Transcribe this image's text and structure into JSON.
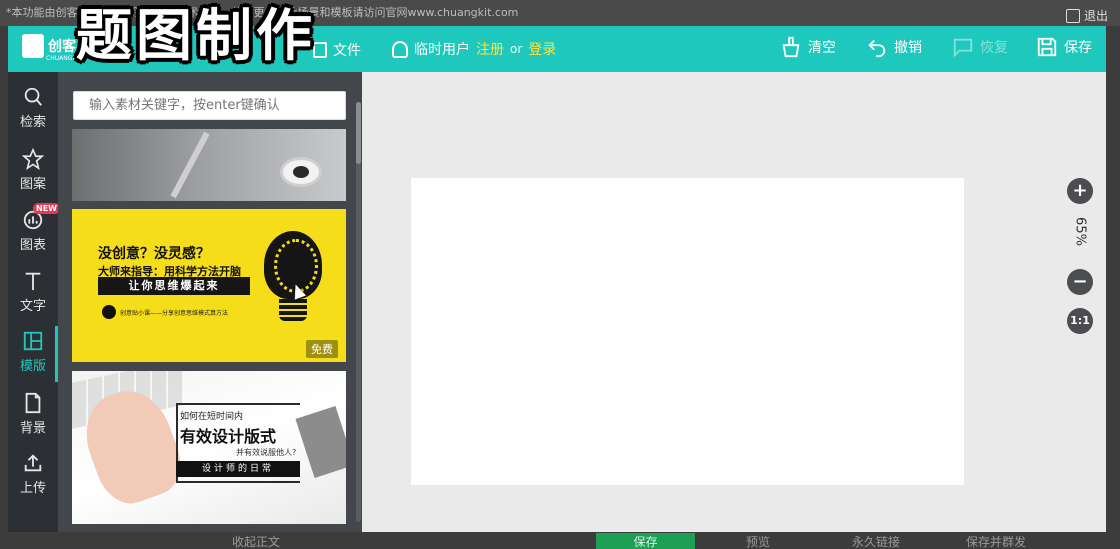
{
  "notice": {
    "text": "*本功能由创客贴提供设计服务提供技术支持，使用更多设计场景和模板请访问官网www.chuangkit.com",
    "exit_label": "退出"
  },
  "overlay_title": "题图制作",
  "topbar": {
    "logo_text": "创客",
    "logo_sub": "CHUANGKIT",
    "file_label": "文件",
    "user_label": "临时用户",
    "register_label": "注册",
    "or_label": "or",
    "login_label": "登录",
    "clear_label": "清空",
    "undo_label": "撤销",
    "redo_label": "恢复",
    "save_label": "保存"
  },
  "rail": {
    "items": [
      {
        "label": "检索",
        "icon": "search-icon"
      },
      {
        "label": "图案",
        "icon": "star-icon"
      },
      {
        "label": "图表",
        "icon": "chart-icon",
        "badge": "NEW"
      },
      {
        "label": "文字",
        "icon": "text-icon"
      },
      {
        "label": "模版",
        "icon": "template-icon",
        "active": true
      },
      {
        "label": "背景",
        "icon": "background-icon"
      },
      {
        "label": "上传",
        "icon": "upload-icon"
      }
    ]
  },
  "panel": {
    "search_placeholder": "输入素材关键字，按enter键确认",
    "card2": {
      "line1": "没创意？没灵感？",
      "line2": "大师来指导：用科学方法开脑",
      "bar": "让你思维爆起来",
      "small": "创意贴小课——分享创意思维模式算方法",
      "free": "免费"
    },
    "card3": {
      "line1": "如何在短时间内",
      "line2": "有效设计版式",
      "line3": "并有效说服他人?",
      "bar": "设计师的日常"
    }
  },
  "canvas": {
    "zoom_in": "+",
    "zoom_out": "−",
    "zoom_level": "65%",
    "ratio": "1:1"
  },
  "bottom": {
    "collapse": "收起正文",
    "save": "保存",
    "preview": "预览",
    "permalink": "永久链接",
    "save_publish": "保存并群发"
  },
  "colors": {
    "accent": "#1fc8bd",
    "yellow": "#ffe33a",
    "rail_bg": "#2c2f33",
    "panel_bg": "#43474c",
    "save_green": "#1f9e55"
  }
}
